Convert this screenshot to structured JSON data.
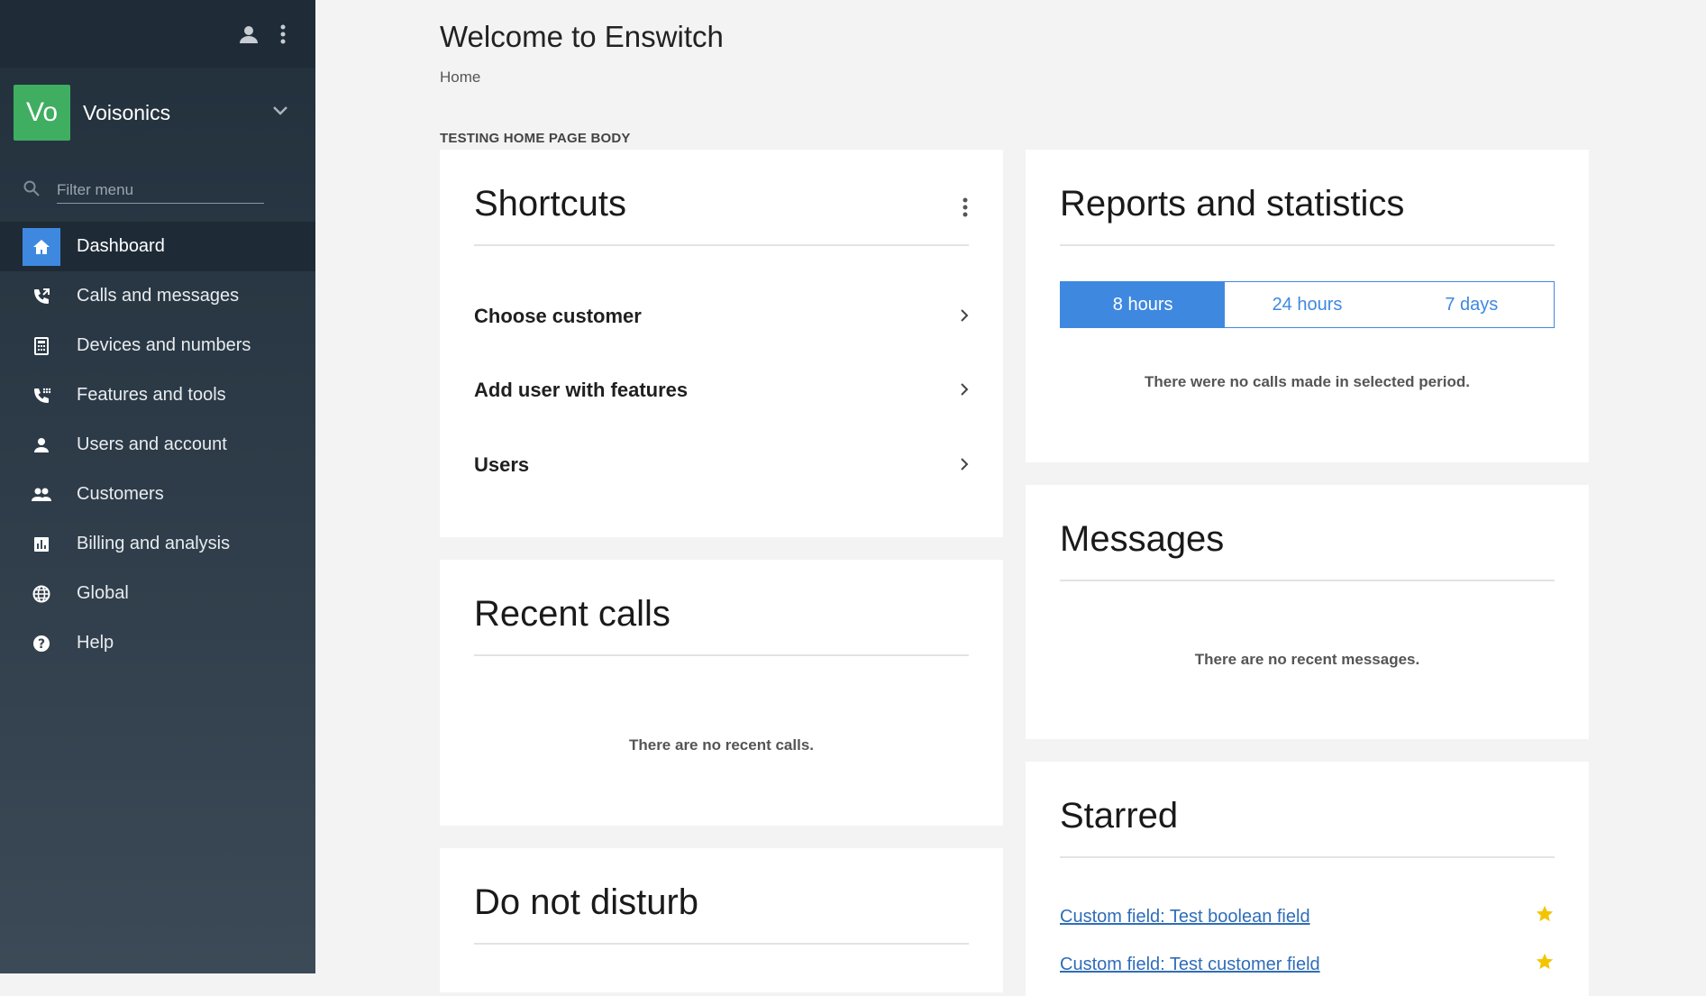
{
  "sidebar": {
    "account_initials": "Vo",
    "account_name": "Voisonics",
    "filter_placeholder": "Filter menu",
    "items": [
      {
        "label": "Dashboard"
      },
      {
        "label": "Calls and messages"
      },
      {
        "label": "Devices and numbers"
      },
      {
        "label": "Features and tools"
      },
      {
        "label": "Users and account"
      },
      {
        "label": "Customers"
      },
      {
        "label": "Billing and analysis"
      },
      {
        "label": "Global"
      },
      {
        "label": "Help"
      }
    ]
  },
  "header": {
    "title": "Welcome to Enswitch",
    "breadcrumb": "Home",
    "body_note": "TESTING HOME PAGE BODY"
  },
  "shortcuts": {
    "title": "Shortcuts",
    "items": [
      "Choose customer",
      "Add user with features",
      "Users"
    ]
  },
  "recent_calls": {
    "title": "Recent calls",
    "empty": "There are no recent calls."
  },
  "dnd": {
    "title": "Do not disturb"
  },
  "reports": {
    "title": "Reports and statistics",
    "tabs": [
      "8 hours",
      "24 hours",
      "7 days"
    ],
    "active_tab": "8 hours",
    "empty": "There were no calls made in selected period."
  },
  "messages": {
    "title": "Messages",
    "empty": "There are no recent messages."
  },
  "starred": {
    "title": "Starred",
    "items": [
      "Custom field: Test boolean field",
      "Custom field: Test customer field"
    ]
  },
  "colors": {
    "accent": "#3f88e0",
    "avatar": "#3fae61",
    "star": "#f2c500"
  }
}
